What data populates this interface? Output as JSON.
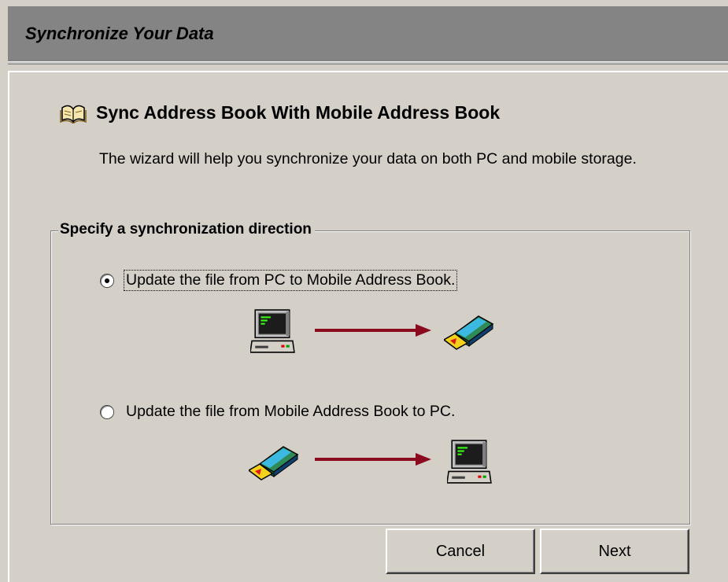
{
  "header": {
    "title": "Synchronize Your Data"
  },
  "section": {
    "title": "Sync Address Book With Mobile Address Book",
    "icon": "open-book-icon",
    "description": "The wizard will help you synchronize your data on both PC and mobile storage."
  },
  "direction_group": {
    "legend": "Specify a synchronization direction",
    "options": [
      {
        "label": "Update the file from PC to Mobile Address Book.",
        "selected": true,
        "from_icon": "computer-icon",
        "to_icon": "mobile-book-icon"
      },
      {
        "label": "Update the file from Mobile Address Book to PC.",
        "selected": false,
        "from_icon": "mobile-book-icon",
        "to_icon": "computer-icon"
      }
    ]
  },
  "buttons": {
    "cancel": "Cancel",
    "next": "Next"
  },
  "colors": {
    "header_bg": "#848484",
    "window_bg": "#d4d0c8",
    "arrow": "#8b0a1e"
  }
}
